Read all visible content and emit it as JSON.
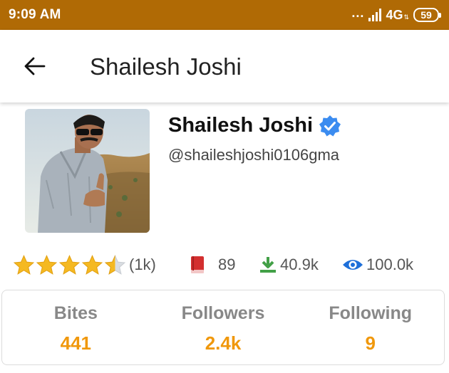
{
  "status_bar": {
    "time": "9:09 AM",
    "dots": "...",
    "network": "4G",
    "battery": "59"
  },
  "app_bar": {
    "title": "Shailesh Joshi"
  },
  "profile": {
    "name": "Shailesh Joshi",
    "handle": "@shaileshjoshi0106gma",
    "verified": true,
    "rating_stars": 4.5,
    "rating_count": "(1k)",
    "books": "89",
    "downloads": "40.9k",
    "views": "100.0k"
  },
  "counts": [
    {
      "label": "Bites",
      "value": "441"
    },
    {
      "label": "Followers",
      "value": "2.4k"
    },
    {
      "label": "Following",
      "value": "9"
    }
  ],
  "colors": {
    "status_bar": "#b06a05",
    "accent_orange": "#f0980c",
    "star": "#f5b921",
    "book_red": "#d32f2f",
    "download_green": "#43a047",
    "eye_blue": "#1e6fd9",
    "verified_blue": "#3b8cf0"
  },
  "icons": {
    "back": "arrow-left-icon",
    "verified": "verified-badge-icon",
    "star": "star-icon",
    "book": "book-icon",
    "download": "download-icon",
    "views": "eye-icon"
  }
}
